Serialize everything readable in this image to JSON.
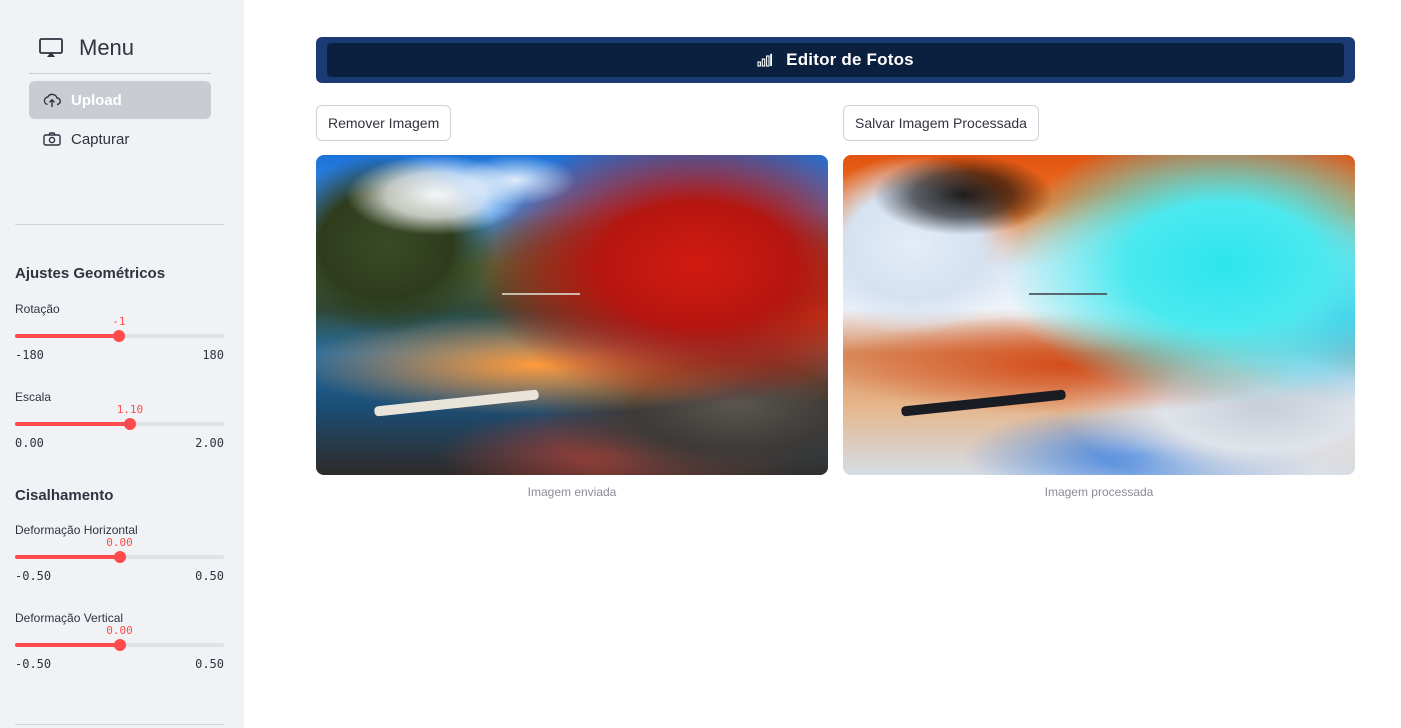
{
  "sidebar": {
    "menu": {
      "title": "Menu",
      "items": [
        {
          "label": "Upload",
          "icon": "cloud-upload-icon",
          "active": true
        },
        {
          "label": "Capturar",
          "icon": "camera-icon",
          "active": false
        }
      ]
    },
    "sections": [
      {
        "title": "Ajustes Geométricos",
        "sliders": [
          {
            "label": "Rotação",
            "value": "-1",
            "min": "-180",
            "max": "180",
            "fraction": 0.497
          },
          {
            "label": "Escala",
            "value": "1.10",
            "min": "0.00",
            "max": "2.00",
            "fraction": 0.55
          }
        ]
      },
      {
        "title": "Cisalhamento",
        "sliders": [
          {
            "label": "Deformação Horizontal",
            "value": "0.00",
            "min": "-0.50",
            "max": "0.50",
            "fraction": 0.5
          },
          {
            "label": "Deformação Vertical",
            "value": "0.00",
            "min": "-0.50",
            "max": "0.50",
            "fraction": 0.5
          }
        ]
      }
    ]
  },
  "main": {
    "banner": {
      "title": "Editor de Fotos",
      "icon": "bar-chart-icon"
    },
    "buttons": {
      "remove": "Remover Imagem",
      "save": "Salvar Imagem Processada"
    },
    "images": {
      "original_caption": "Imagem enviada",
      "processed_caption": "Imagem processada"
    }
  },
  "colors": {
    "accent": "#ff4b4b",
    "banner_outer": "#1a3b73",
    "banner_inner": "#0b1f3f",
    "sidebar_bg": "#f0f2f6"
  }
}
